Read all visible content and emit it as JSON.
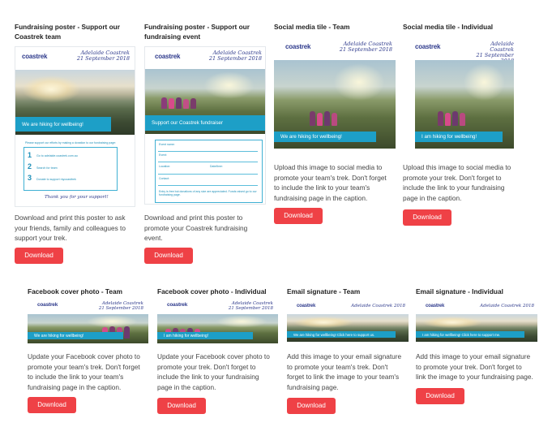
{
  "download_label": "Download",
  "brand": {
    "name": "coastrek",
    "tagline": "beyond blue"
  },
  "event_script": {
    "line1": "Adelaide Coastrek",
    "line2": "21 September 2018",
    "single": "Adelaide Coastrek 2018"
  },
  "cards": [
    {
      "title": "Fundraising poster - Support our Coastrek team",
      "title_l1": "Fundraising poster - Support our",
      "title_l2": "Coastrek team",
      "desc_l1": "Download and print this poster to ask",
      "desc_l2": "your friends, family and colleagues to",
      "desc_l3": "support your trek.",
      "banner": "We are hiking for wellbeing!",
      "support_line": "Please support our efforts by making a donation to our fundraising page:",
      "steps": [
        "Go to adelaide.coastrek.com.au",
        "Search for team",
        "Donate to support mycoasttrek"
      ],
      "thanks": "Thank you for your support!"
    },
    {
      "title_l1": "Fundraising poster - Support our",
      "title_l2": "fundraising event",
      "desc_l1": "Download and print this poster to",
      "desc_l2": "promote your Coastrek fundraising",
      "desc_l3": "event.",
      "banner": "Support our Coastrek fundraiser",
      "form_labels": [
        "Event name:",
        "Event:",
        "Location:",
        "Date/time:",
        "Contact:"
      ],
      "form_footer": "Entry is free but donations of any size are appreciated. Funds raised go to our fundraising page."
    },
    {
      "title": "Social media tile - Team",
      "desc_l1": "Upload this image to social media to",
      "desc_l2": "promote your team's trek. Don't forget",
      "desc_l3": "to include the link to your team's",
      "desc_l4": "fundraising page in the caption.",
      "banner": "We are hiking for wellbeing!"
    },
    {
      "title": "Social media tile - Individual",
      "desc_l1": "Upload this image to social media to",
      "desc_l2": "promote your trek. Don't forget to",
      "desc_l3": "include the link to your fundraising",
      "desc_l4": "page in the caption.",
      "banner": "I am hiking for wellbeing!"
    },
    {
      "title": "Facebook cover photo - Team",
      "desc_l1": "Update your Facebook cover photo to",
      "desc_l2": "promote your team's trek. Don't forget",
      "desc_l3": "to include the link to your team's",
      "desc_l4": "fundraising page in the caption.",
      "banner": "We are hiking for wellbeing!"
    },
    {
      "title": "Facebook cover photo - Individual",
      "desc_l1": "Update your Facebook cover photo to",
      "desc_l2": "promote your trek. Don't forget to",
      "desc_l3": "include the link to your fundraising",
      "desc_l4": "page in the caption.",
      "banner": "I am hiking for wellbeing!"
    },
    {
      "title": "Email signature - Team",
      "desc_l1": "Add this image to your email signature",
      "desc_l2": "to promote your team's trek. Don't",
      "desc_l3": "forget to link the image to your team's",
      "desc_l4": "fundraising page.",
      "banner": "We are hiking for wellbeing! Click here to support us."
    },
    {
      "title": "Email signature - Individual",
      "desc_l1": "Add this image to your email signature",
      "desc_l2": "to promote your trek. Don't forget to",
      "desc_l3": "link the image to your fundraising page.",
      "banner": "I am hiking for wellbeing! Click here to support me."
    }
  ],
  "colors": {
    "button": "#ef4146",
    "banner": "#1d9fc7",
    "brand": "#2e3a8c"
  }
}
